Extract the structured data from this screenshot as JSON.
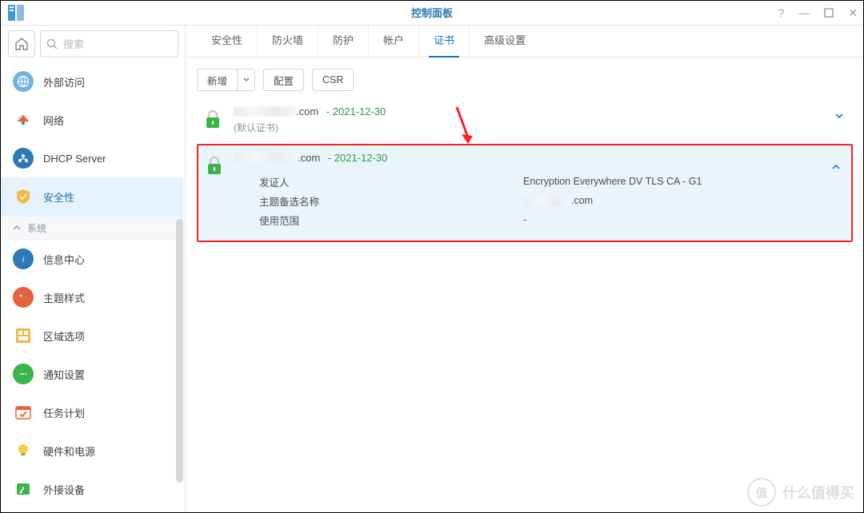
{
  "window": {
    "title": "控制面板"
  },
  "search": {
    "placeholder": "搜索"
  },
  "sidebar": {
    "items": [
      {
        "label": "外部访问"
      },
      {
        "label": "网络"
      },
      {
        "label": "DHCP Server"
      },
      {
        "label": "安全性"
      }
    ],
    "section": "系统",
    "items2": [
      {
        "label": "信息中心"
      },
      {
        "label": "主题样式"
      },
      {
        "label": "区域选项"
      },
      {
        "label": "通知设置"
      },
      {
        "label": "任务计划"
      },
      {
        "label": "硬件和电源"
      },
      {
        "label": "外接设备"
      }
    ]
  },
  "tabs": [
    "安全性",
    "防火墙",
    "防护",
    "帐户",
    "证书",
    "高级设置"
  ],
  "active_tab": 4,
  "toolbar": {
    "add": "新增",
    "configure": "配置",
    "csr": "CSR"
  },
  "certs": [
    {
      "domain_suffix": ".com",
      "expiry": "2021-12-30",
      "default_label": "(默认证书)",
      "expanded": false
    },
    {
      "domain_suffix": ".com",
      "expiry": "2021-12-30",
      "expanded": true,
      "details": {
        "issuer_label": "发证人",
        "issuer_value": "Encryption Everywhere DV TLS CA - G1",
        "san_label": "主题备选名称",
        "san_suffix": ".com",
        "scope_label": "使用范围",
        "scope_value": "-"
      }
    }
  ],
  "watermark": {
    "badge": "值",
    "text": "什么值得买"
  }
}
